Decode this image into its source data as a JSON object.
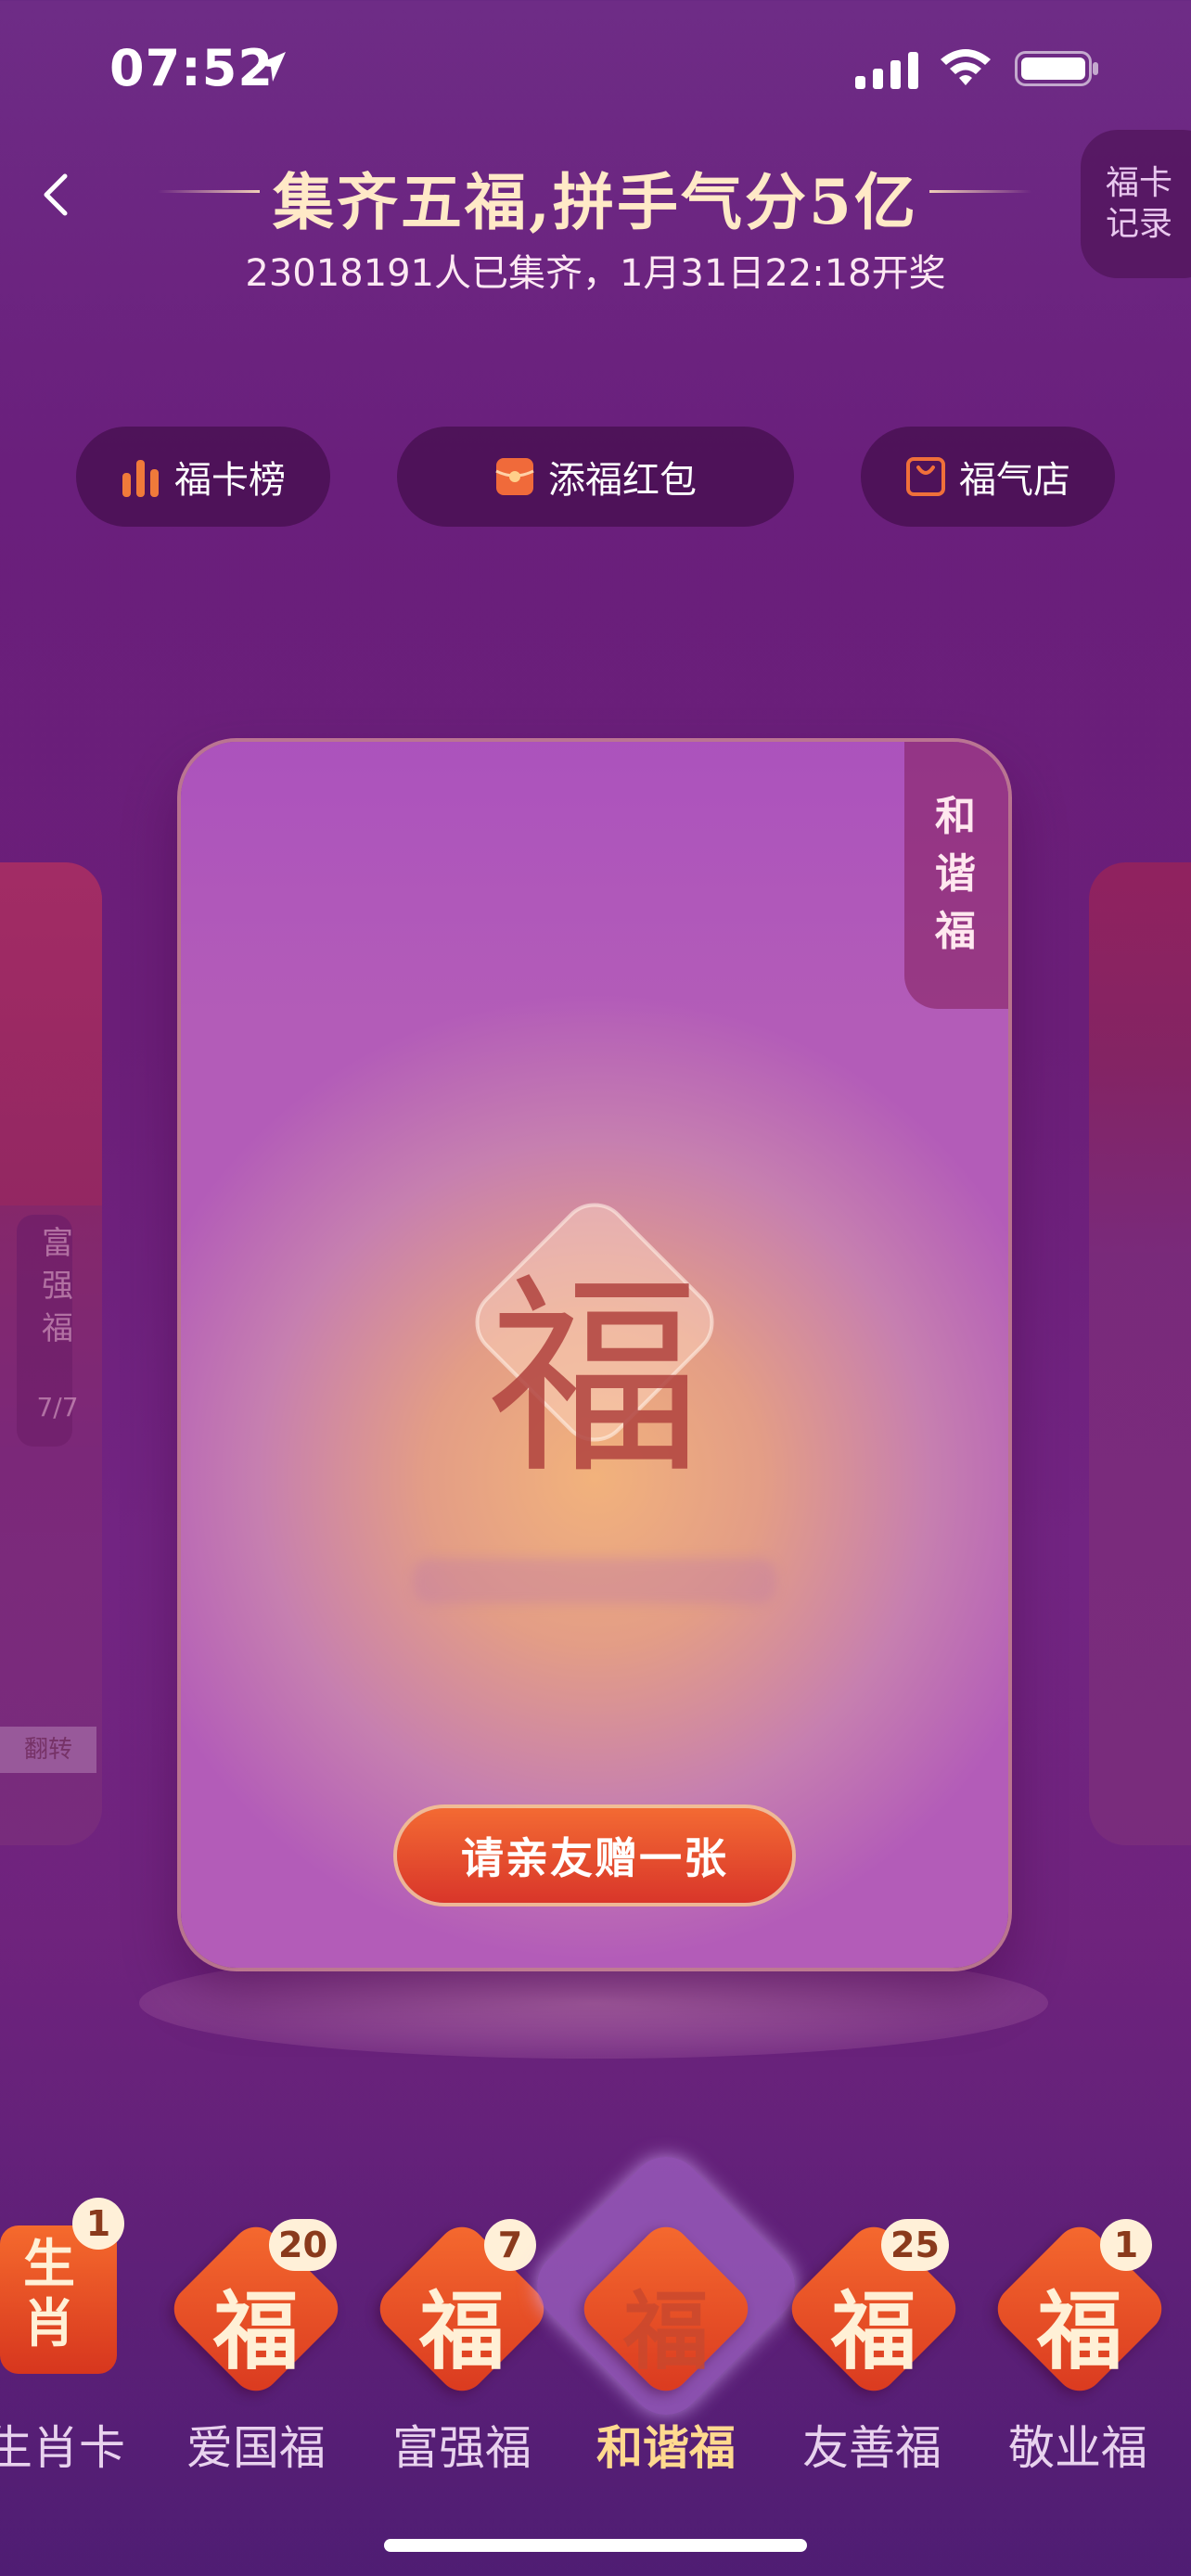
{
  "status_bar": {
    "time": "07:52"
  },
  "header": {
    "title": "集齐五福,拼手气分5亿",
    "subtitle": "23018191人已集齐，1月31日22:18开奖",
    "record_label": "福卡记录"
  },
  "pills": [
    {
      "label": "福卡榜",
      "icon": "bar-chart-icon"
    },
    {
      "label": "添福红包",
      "icon": "red-envelope-icon"
    },
    {
      "label": "福气店",
      "icon": "shopping-bag-icon"
    }
  ],
  "side_left": {
    "tag": "富强福",
    "count": "7/7",
    "flip": "翻转"
  },
  "main_card": {
    "tag": "和谐福",
    "fu": "福",
    "action_label": "请亲友赠一张"
  },
  "bottom_cards": [
    {
      "label": "生肖卡",
      "count": "1",
      "char": "生肖"
    },
    {
      "label": "爱国福",
      "count": "20",
      "char": "福"
    },
    {
      "label": "富强福",
      "count": "7",
      "char": "福"
    },
    {
      "label": "和谐福",
      "count": "",
      "char": "福",
      "active": true
    },
    {
      "label": "友善福",
      "count": "25",
      "char": "福"
    },
    {
      "label": "敬业福",
      "count": "1",
      "char": "福"
    }
  ],
  "colors": {
    "background": "#6b1e78",
    "accent_orange": "#f36a33",
    "title_gold": "#ffe9c7",
    "active_label": "#ffd98f"
  }
}
